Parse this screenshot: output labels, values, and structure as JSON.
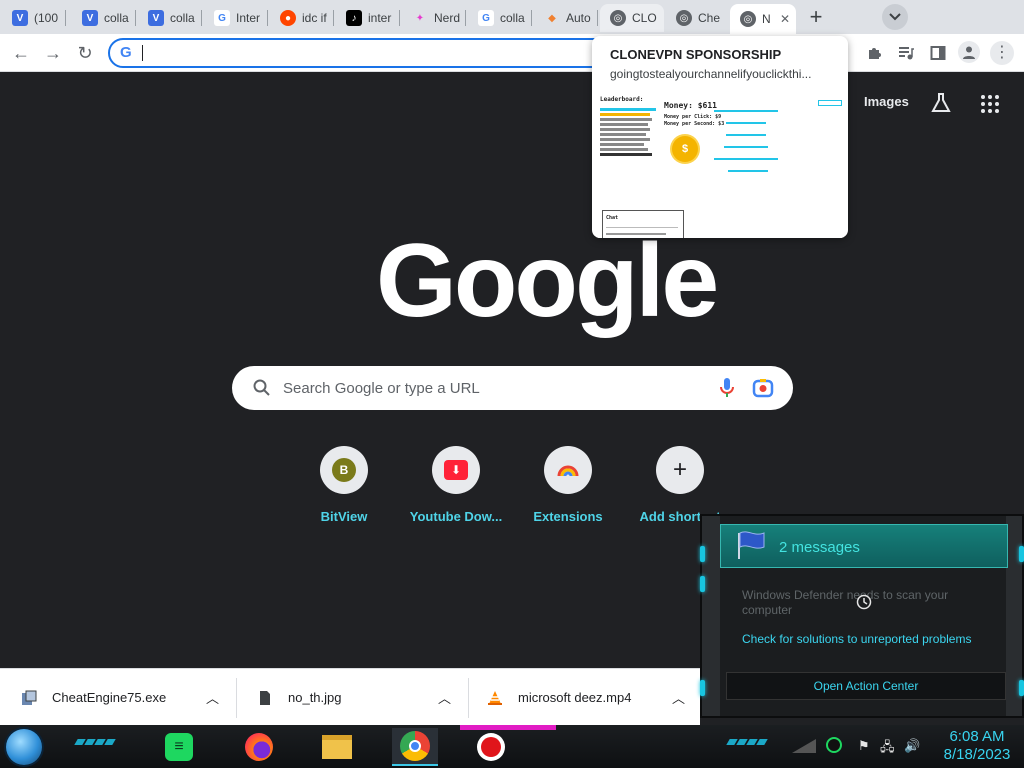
{
  "browser": {
    "tabs": [
      {
        "label": "(100",
        "favicon": "V",
        "color": "#3d6de0"
      },
      {
        "label": "colla",
        "favicon": "V",
        "color": "#3d6de0"
      },
      {
        "label": "colla",
        "favicon": "V",
        "color": "#3d6de0"
      },
      {
        "label": "Inter",
        "favicon": "G",
        "color": "#4285f4"
      },
      {
        "label": "idc if",
        "favicon": "reddit",
        "color": "#ff4500"
      },
      {
        "label": "inter",
        "favicon": "tiktok",
        "color": "#000000"
      },
      {
        "label": "Nerd",
        "favicon": "nerd",
        "color": "#e63ccf"
      },
      {
        "label": "colla",
        "favicon": "G",
        "color": "#4285f4"
      },
      {
        "label": "Auto",
        "favicon": "auto",
        "color": "#f08030"
      },
      {
        "label": "CLO",
        "favicon": "globe",
        "color": "#5f6368"
      },
      {
        "label": "Che",
        "favicon": "globe",
        "color": "#5f6368"
      },
      {
        "label": "N",
        "favicon": "chrome",
        "color": "#5f6368"
      }
    ],
    "omnibox_value": ""
  },
  "hovercard": {
    "title": "CLONEVPN SPONSORSHIP",
    "url": "goingtostealyourchannelifyouclickthi..."
  },
  "preview": {
    "leaderboard": "Leaderboard:",
    "money": "Money: $611",
    "per_click": "Money per Click: $9",
    "per_second": "Money per Second: $3",
    "chat": "Chat"
  },
  "ntp": {
    "images_link": "Images",
    "logo": "Google",
    "search_placeholder": "Search Google or type a URL",
    "shortcuts": [
      {
        "label": "BitView",
        "icon": "B"
      },
      {
        "label": "Youtube Dow...",
        "icon": "youtube-download"
      },
      {
        "label": "Extensions",
        "icon": "chrome"
      },
      {
        "label": "Add shortcut",
        "icon": "+"
      }
    ]
  },
  "downloads": [
    {
      "name": "CheatEngine75.exe",
      "icon": "exe"
    },
    {
      "name": "no_th.jpg",
      "icon": "file"
    },
    {
      "name": "microsoft deez.mp4",
      "icon": "vlc"
    }
  ],
  "action_center": {
    "header": "2 messages",
    "message1": "Windows Defender needs to scan your computer",
    "message2": "Check for solutions to unreported problems",
    "button": "Open Action Center"
  },
  "taskbar": {
    "time": "6:08 AM",
    "date": "8/18/2023"
  },
  "colors": {
    "accent": "#1a73e8",
    "ntp_bg": "#202124",
    "shortcut_label": "#4fd4e8",
    "taskbar_accent": "#38d4f0"
  }
}
